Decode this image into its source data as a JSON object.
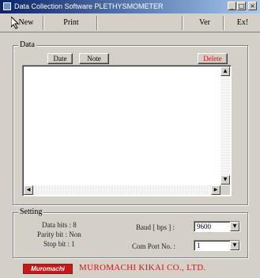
{
  "window": {
    "title": "Data Collection Software PLETHYSMOMETER",
    "controls": [
      "_",
      "□",
      "×"
    ]
  },
  "menu": {
    "items": [
      "New",
      "Print",
      "Ver",
      "Ex!"
    ]
  },
  "data_group": {
    "legend": "Data",
    "date_button": "Date",
    "note_button": "Note",
    "delete_button": "Delete"
  },
  "setting_group": {
    "legend": "Setting",
    "data_bits": "Data bits : 8",
    "parity_bit": "Parity bit : Non",
    "stop_bit": "Stop bit : 1",
    "baud_label": "Baud [ bps ] :",
    "baud_value": "9600",
    "comport_label": "Com Port No. :",
    "comport_value": "1"
  },
  "footer": {
    "logo_text": "Muromachi",
    "company": "MUROMACHI KIKAI CO., LTD."
  }
}
